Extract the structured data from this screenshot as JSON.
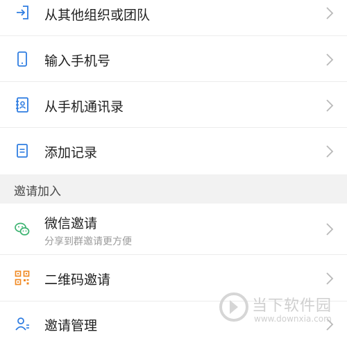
{
  "items": [
    {
      "label": "从其他组织或团队",
      "icon": "login-arrow-icon"
    },
    {
      "label": "输入手机号",
      "icon": "phone-icon"
    },
    {
      "label": "从手机通讯录",
      "icon": "contacts-book-icon"
    },
    {
      "label": "添加记录",
      "icon": "document-icon"
    }
  ],
  "section_title": "邀请加入",
  "invite_items": [
    {
      "label": "微信邀请",
      "sublabel": "分享到群邀请更方便",
      "icon": "wechat-icon"
    },
    {
      "label": "二维码邀请",
      "icon": "qr-code-icon"
    },
    {
      "label": "邀请管理",
      "icon": "user-manage-icon"
    }
  ],
  "colors": {
    "accent_blue": "#2f7de1",
    "wechat_green": "#3cb371",
    "qr_orange": "#f08a24"
  },
  "watermark": {
    "title": "当下软件园",
    "url": "www.downxia.com"
  }
}
